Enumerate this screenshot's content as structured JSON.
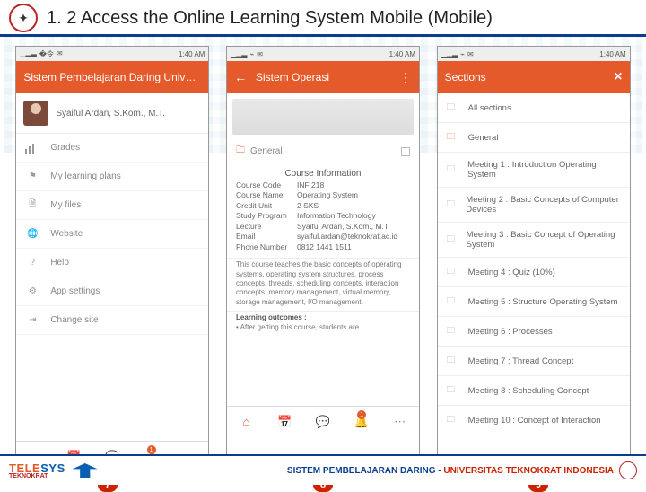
{
  "header": {
    "title": "1. 2 Access the Online Learning System Mobile (Mobile)"
  },
  "statusbar": {
    "time": "1:40 AM"
  },
  "screen7": {
    "appbar_title": "Sistem Pembelajaran Daring Universitas ..",
    "profile_name": "Syaiful Ardan, S.Kom., M.T.",
    "menu": [
      {
        "icon": "bars",
        "label": "Grades"
      },
      {
        "icon": "flag",
        "label": "My learning plans"
      },
      {
        "icon": "file",
        "label": "My files"
      },
      {
        "icon": "globe",
        "label": "Website"
      },
      {
        "icon": "question",
        "label": "Help"
      },
      {
        "icon": "gear",
        "label": "App settings"
      },
      {
        "icon": "exit",
        "label": "Change site"
      }
    ]
  },
  "screen8": {
    "appbar_title": "Sistem Operasi",
    "folder_label": "General",
    "info_title": "Course Information",
    "info": [
      {
        "k": "Course Code",
        "v": "INF 218"
      },
      {
        "k": "Course Name",
        "v": "Operating System"
      },
      {
        "k": "Credit Unit",
        "v": "2 SKS"
      },
      {
        "k": "Study Program",
        "v": "Information Technology"
      },
      {
        "k": "Lecture",
        "v": "Syaiful Ardan, S.Kom., M.T"
      },
      {
        "k": "Email",
        "v": "syaiful.ardan@teknokrat.ac.id"
      },
      {
        "k": "Phone Number",
        "v": "0812 1441 1511"
      }
    ],
    "desc": "This course teaches the basic concepts of operating systems, operating system structures, process concepts, threads, scheduling concepts, interaction concepts, memory management, virtual memory, storage management, I/O management.",
    "outcome_title": "Learning outcomes :",
    "outcome_line": "• After getting this course, students are"
  },
  "screen9": {
    "appbar_title": "Sections",
    "items": [
      "All sections",
      "General",
      "Meeting 1 : Introduction Operating System",
      "Meeting 2 : Basic Concepts of Computer Devices",
      "Meeting 3 : Basic Concept of Operating System",
      "Meeting 4 : Quiz (10%)",
      "Meeting 5 : Structure Operating System",
      "Meeting 6 : Processes",
      "Meeting 7 : Thread Concept",
      "Meeting 8 : Scheduling Concept",
      "Meeting 10 : Concept of Interaction"
    ]
  },
  "labels": {
    "a": "7",
    "b": "8",
    "c": "9"
  },
  "footer": {
    "brand1": "TELE",
    "brand2": "SYS",
    "brand_sub": "TEKNOKRAT",
    "text1": "SISTEM PEMBELAJARAN DARING - ",
    "text2": "UNIVERSITAS TEKNOKRAT INDONESIA"
  }
}
